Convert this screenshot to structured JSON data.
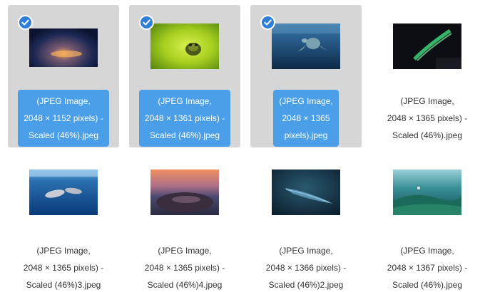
{
  "files": [
    {
      "selected": true,
      "name_lines": [
        "(JPEG Image,",
        "2048 × 1152 pixels) -",
        "Scaled (46%).jpeg"
      ],
      "thumb": "nebula-night-sky"
    },
    {
      "selected": true,
      "name_lines": [
        "(JPEG Image,",
        "2048 × 1361 pixels) -",
        "Scaled (46%).jpeg"
      ],
      "thumb": "frog-in-green-water"
    },
    {
      "selected": true,
      "name_lines": [
        "(JPEG Image,",
        "2048 × 1365",
        "pixels).jpeg"
      ],
      "thumb": "sea-turtle-underwater"
    },
    {
      "selected": false,
      "name_lines": [
        "(JPEG Image,",
        "2048 × 1365 pixels) -",
        "Scaled (46%).jpeg"
      ],
      "thumb": "aurora-night"
    },
    {
      "selected": false,
      "name_lines": [
        "(JPEG Image,",
        "2048 × 1365 pixels) -",
        "Scaled (46%)3.jpeg"
      ],
      "thumb": "dolphins-underwater"
    },
    {
      "selected": false,
      "name_lines": [
        "(JPEG Image,",
        "2048 × 1365 pixels) -",
        "Scaled (46%)4.jpeg"
      ],
      "thumb": "sunset-shore"
    },
    {
      "selected": false,
      "name_lines": [
        "(JPEG Image,",
        "2048 × 1366 pixels) -",
        "Scaled (46%)2.jpeg"
      ],
      "thumb": "whale-deep-water"
    },
    {
      "selected": false,
      "name_lines": [
        "(JPEG Image,",
        "2048 × 1367 pixels) -",
        "Scaled (46%).jpeg"
      ],
      "thumb": "diver-reef"
    }
  ],
  "colors": {
    "selection_background": "#d6d6d6",
    "label_highlight": "#4a9fe8",
    "check_badge": "#2f7fd8"
  }
}
